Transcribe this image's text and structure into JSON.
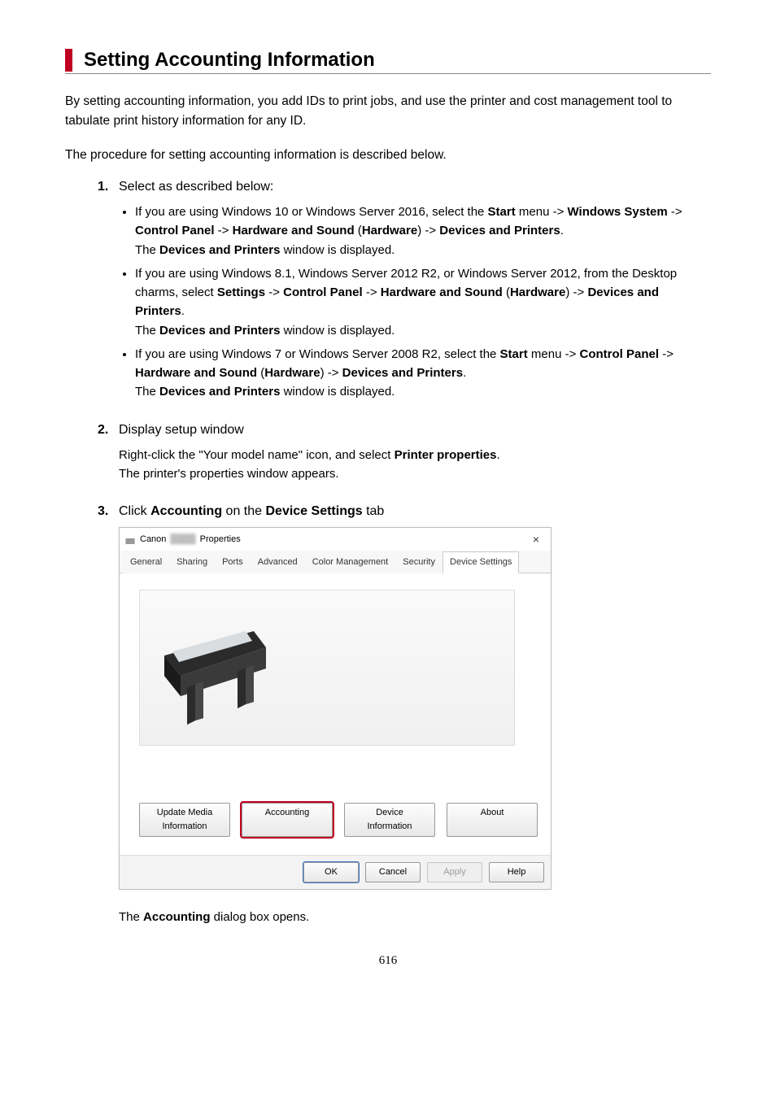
{
  "heading": "Setting Accounting Information",
  "intro1": "By setting accounting information, you add IDs to print jobs, and use the printer and cost management tool to tabulate print history information for any ID.",
  "intro2": "The procedure for setting accounting information is described below.",
  "steps": {
    "s1": {
      "num": "1.",
      "title": "Select as described below:",
      "b1": {
        "pre": "If you are using Windows 10 or Windows Server 2016, select the ",
        "start": "Start",
        "m1": " menu -> ",
        "winSys": "Windows System",
        "m2": " -> ",
        "cp": "Control Panel",
        "m3": " -> ",
        "hs": "Hardware and Sound",
        "m4": " (",
        "hw": "Hardware",
        "m5": ") -> ",
        "dp": "Devices and Printers",
        "end": ".",
        "line2a": "The ",
        "line2b": "Devices and Printers",
        "line2c": " window is displayed."
      },
      "b2": {
        "pre": "If you are using Windows 8.1, Windows Server 2012 R2, or Windows Server 2012, from the Desktop charms, select ",
        "settings": "Settings",
        "m1": " -> ",
        "cp": "Control Panel",
        "m2": " -> ",
        "hs": "Hardware and Sound",
        "m3": " (",
        "hw": "Hardware",
        "m4": ") -> ",
        "dp": "Devices and Printers",
        "end": ".",
        "line2a": "The ",
        "line2b": "Devices and Printers",
        "line2c": " window is displayed."
      },
      "b3": {
        "pre": "If you are using Windows 7 or Windows Server 2008 R2, select the ",
        "start": "Start",
        "m1": " menu -> ",
        "cp": "Control Panel",
        "m2": " -> ",
        "hs": "Hardware and Sound",
        "m3": " (",
        "hw": "Hardware",
        "m4": ") -> ",
        "dp": "Devices and Printers",
        "end": ".",
        "line2a": "The ",
        "line2b": "Devices and Printers",
        "line2c": " window is displayed."
      }
    },
    "s2": {
      "num": "2.",
      "title": "Display setup window",
      "body1a": "Right-click the \"Your model name\" icon, and select ",
      "body1b": "Printer properties",
      "body1c": ".",
      "body2": "The printer's properties window appears."
    },
    "s3": {
      "num": "3.",
      "title_pre": "Click ",
      "title_b1": "Accounting",
      "title_mid": " on the ",
      "title_b2": "Device Settings",
      "title_post": " tab",
      "after_a": "The ",
      "after_b": "Accounting",
      "after_c": " dialog box opens."
    }
  },
  "dialog": {
    "titlePrefix": "Canon",
    "titleSuffix": "Properties",
    "close": "×",
    "tabs": {
      "general": "General",
      "sharing": "Sharing",
      "ports": "Ports",
      "advanced": "Advanced",
      "color": "Color Management",
      "security": "Security",
      "device": "Device Settings"
    },
    "buttons": {
      "update": "Update Media Information",
      "accounting": "Accounting",
      "deviceInfo": "Device Information",
      "about": "About"
    },
    "footer": {
      "ok": "OK",
      "cancel": "Cancel",
      "apply": "Apply",
      "help": "Help"
    }
  },
  "pageNumber": "616"
}
